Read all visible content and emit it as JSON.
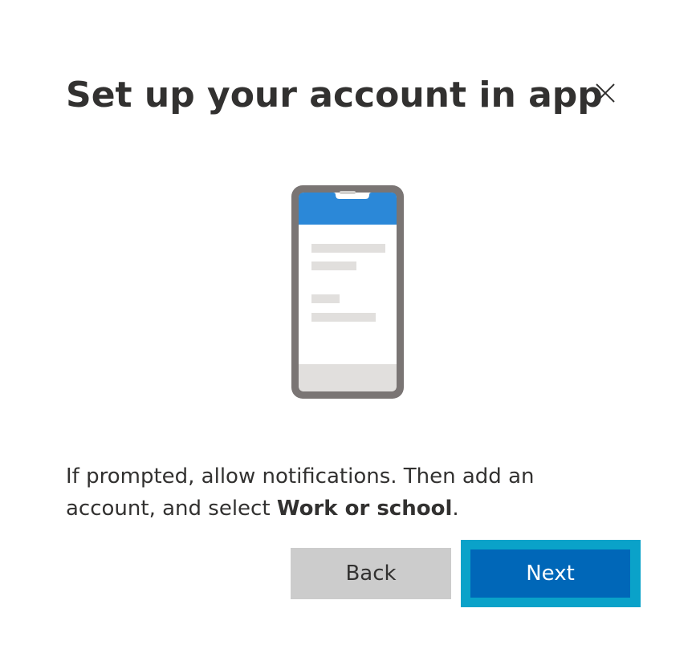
{
  "dialog": {
    "title": "Set up your account in app",
    "message_part1": "If prompted, allow notifications. Then add an account, and select ",
    "message_bold": "Work or school",
    "message_part2": ".",
    "close_icon": "close-icon",
    "illustration_icon": "phone-illustration"
  },
  "buttons": {
    "back_label": "Back",
    "next_label": "Next"
  },
  "colors": {
    "accent": "#0067b8",
    "focus_outline": "#0aa2c9",
    "back_button": "#cccccc",
    "phone_header": "#2b88d8"
  }
}
